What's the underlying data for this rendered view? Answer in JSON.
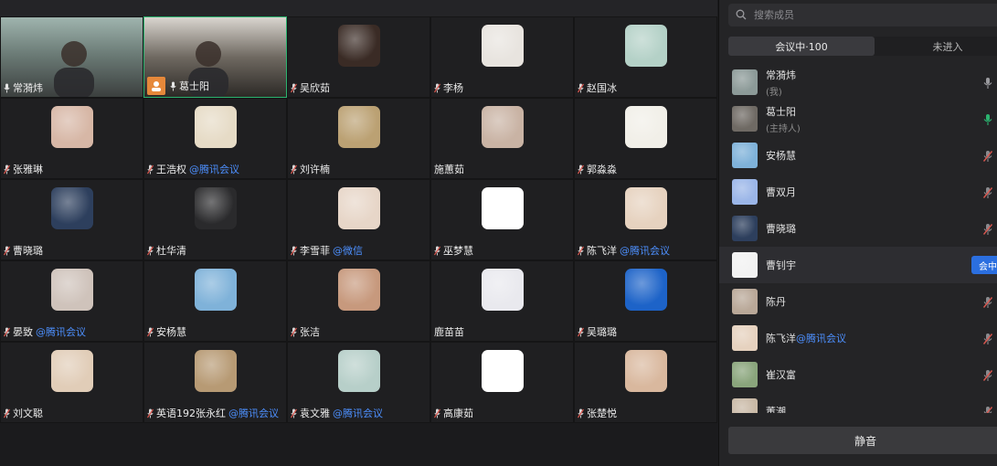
{
  "grid": {
    "tiles": [
      {
        "name": "常漪炜",
        "suffix": "",
        "mic": "on",
        "type": "video"
      },
      {
        "name": "葛士阳",
        "suffix": "",
        "mic": "on",
        "type": "video",
        "host": true,
        "active": true
      },
      {
        "name": "吴欣茹",
        "suffix": "",
        "mic": "muted",
        "color": "#3a2b25"
      },
      {
        "name": "李杨",
        "suffix": "",
        "mic": "muted",
        "color": "#e8e4df"
      },
      {
        "name": "赵国冰",
        "suffix": "",
        "mic": "muted",
        "color": "#b4d1c7"
      },
      {
        "name": "张雅琳",
        "suffix": "",
        "mic": "muted",
        "color": "#d7b7a6"
      },
      {
        "name": "王浩权",
        "suffix": "@腾讯会议",
        "mic": "muted",
        "color": "#e6dbc6"
      },
      {
        "name": "刘许楠",
        "suffix": "",
        "mic": "muted",
        "color": "#bba173"
      },
      {
        "name": "施蕙茹",
        "suffix": "",
        "mic": "none",
        "color": "#c9b3a4"
      },
      {
        "name": "郭淼淼",
        "suffix": "",
        "mic": "muted",
        "color": "#f1efe8"
      },
      {
        "name": "曹晓璐",
        "suffix": "",
        "mic": "muted",
        "color": "#2d3f5d"
      },
      {
        "name": "杜华清",
        "suffix": "",
        "mic": "muted",
        "color": "#2a2a2c"
      },
      {
        "name": "李雪菲",
        "suffix": "@微信",
        "mic": "muted",
        "color": "#e7d6c8"
      },
      {
        "name": "巫梦慧",
        "suffix": "",
        "mic": "muted",
        "color": "#ffffff"
      },
      {
        "name": "陈飞洋",
        "suffix": "@腾讯会议",
        "mic": "muted",
        "color": "#e6d2bf"
      },
      {
        "name": "晏致",
        "suffix": "@腾讯会议",
        "mic": "muted",
        "color": "#cfc3bb"
      },
      {
        "name": "安杨慧",
        "suffix": "",
        "mic": "muted",
        "color": "#7fb2d9"
      },
      {
        "name": "张洁",
        "suffix": "",
        "mic": "muted",
        "color": "#c7997d"
      },
      {
        "name": "鹿苗苗",
        "suffix": "",
        "mic": "none",
        "color": "#e9e9ee"
      },
      {
        "name": "吴璐璐",
        "suffix": "",
        "mic": "muted",
        "color": "#1d63c8"
      },
      {
        "name": "刘文聪",
        "suffix": "",
        "mic": "muted",
        "color": "#e1cdb8"
      },
      {
        "name": "英语192张永红",
        "suffix": "@腾讯会议",
        "mic": "muted",
        "color": "#b79a74"
      },
      {
        "name": "袁文雅",
        "suffix": "@腾讯会议",
        "mic": "muted",
        "color": "#b7cfc9"
      },
      {
        "name": "高康茹",
        "suffix": "",
        "mic": "muted",
        "color": "#ffffff"
      },
      {
        "name": "张楚悦",
        "suffix": "",
        "mic": "muted",
        "color": "#d9b89e"
      }
    ]
  },
  "panel": {
    "search_placeholder": "搜索成员",
    "tabs": [
      {
        "label": "会议中·100",
        "selected": true
      },
      {
        "label": "未进入",
        "selected": false
      }
    ],
    "members": [
      {
        "name": "常漪炜",
        "suffix": "",
        "role": "(我)",
        "mic": "on",
        "color": "#8c9a98"
      },
      {
        "name": "葛士阳",
        "suffix": "",
        "role": "(主持人)",
        "mic": "active",
        "color": "#6f6a64"
      },
      {
        "name": "安杨慧",
        "suffix": "",
        "role": "",
        "mic": "muted",
        "color": "#7fb2d9"
      },
      {
        "name": "曹双月",
        "suffix": "",
        "role": "",
        "mic": "muted",
        "color": "#9bb6e8"
      },
      {
        "name": "曹晓璐",
        "suffix": "",
        "role": "",
        "mic": "muted",
        "color": "#2d3f5d"
      },
      {
        "name": "曹钊宇",
        "suffix": "",
        "role": "",
        "mic": "invite",
        "color": "#f2f2f2",
        "highlight": true,
        "invite_label": "会中邀"
      },
      {
        "name": "陈丹",
        "suffix": "",
        "role": "",
        "mic": "muted",
        "color": "#b9a898"
      },
      {
        "name": "陈飞洋",
        "suffix": "@腾讯会议",
        "role": "",
        "mic": "muted",
        "color": "#e6d2bf"
      },
      {
        "name": "崔汉富",
        "suffix": "",
        "role": "",
        "mic": "muted",
        "color": "#8aa57c"
      },
      {
        "name": "董潮",
        "suffix": "",
        "role": "",
        "mic": "muted",
        "color": "#c9b9a6"
      }
    ],
    "mute_all_label": "静音"
  },
  "colors": {
    "accent_blue": "#4d90ff",
    "muted_red": "#d9574f",
    "active_green": "#2bb36f",
    "host_orange": "#e6883a"
  }
}
